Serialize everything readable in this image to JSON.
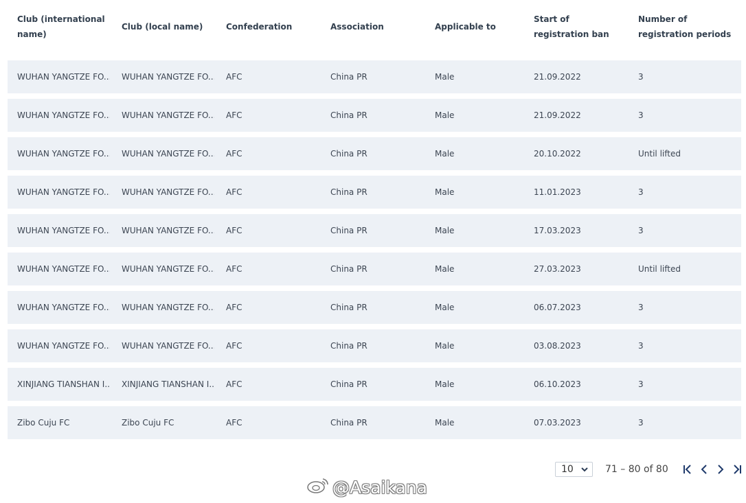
{
  "table": {
    "headers": [
      "Club (international name)",
      "Club (local name)",
      "Confederation",
      "Association",
      "Applicable to",
      "Start of registration ban",
      "Number of registration periods"
    ],
    "rows": [
      [
        "WUHAN YANGTZE FO...",
        "WUHAN YANGTZE FO...",
        "AFC",
        "China PR",
        "Male",
        "21.09.2022",
        "3"
      ],
      [
        "WUHAN YANGTZE FO...",
        "WUHAN YANGTZE FO...",
        "AFC",
        "China PR",
        "Male",
        "21.09.2022",
        "3"
      ],
      [
        "WUHAN YANGTZE FO...",
        "WUHAN YANGTZE FO...",
        "AFC",
        "China PR",
        "Male",
        "20.10.2022",
        "Until lifted"
      ],
      [
        "WUHAN YANGTZE FO...",
        "WUHAN YANGTZE FO...",
        "AFC",
        "China PR",
        "Male",
        "11.01.2023",
        "3"
      ],
      [
        "WUHAN YANGTZE FO...",
        "WUHAN YANGTZE FO...",
        "AFC",
        "China PR",
        "Male",
        "17.03.2023",
        "3"
      ],
      [
        "WUHAN YANGTZE FO...",
        "WUHAN YANGTZE FO...",
        "AFC",
        "China PR",
        "Male",
        "27.03.2023",
        "Until lifted"
      ],
      [
        "WUHAN YANGTZE FO...",
        "WUHAN YANGTZE FO...",
        "AFC",
        "China PR",
        "Male",
        "06.07.2023",
        "3"
      ],
      [
        "WUHAN YANGTZE FO...",
        "WUHAN YANGTZE FO...",
        "AFC",
        "China PR",
        "Male",
        "03.08.2023",
        "3"
      ],
      [
        "XINJIANG TIANSHAN I...",
        "XINJIANG TIANSHAN I...",
        "AFC",
        "China PR",
        "Male",
        "06.10.2023",
        "3"
      ],
      [
        "Zibo Cuju FC",
        "Zibo Cuju FC",
        "AFC",
        "China PR",
        "Male",
        "07.03.2023",
        "3"
      ]
    ]
  },
  "pagination": {
    "page_size": "10",
    "range_label": "71 – 80 of 80",
    "icons": [
      "first-page-icon",
      "previous-page-icon",
      "next-page-icon",
      "last-page-icon"
    ]
  },
  "watermark": {
    "text": "@Asaikana",
    "icon": "weibo-icon"
  },
  "colors": {
    "row_background": "#edf1f6",
    "header_text": "#33404f",
    "cell_text": "#3c4552"
  }
}
